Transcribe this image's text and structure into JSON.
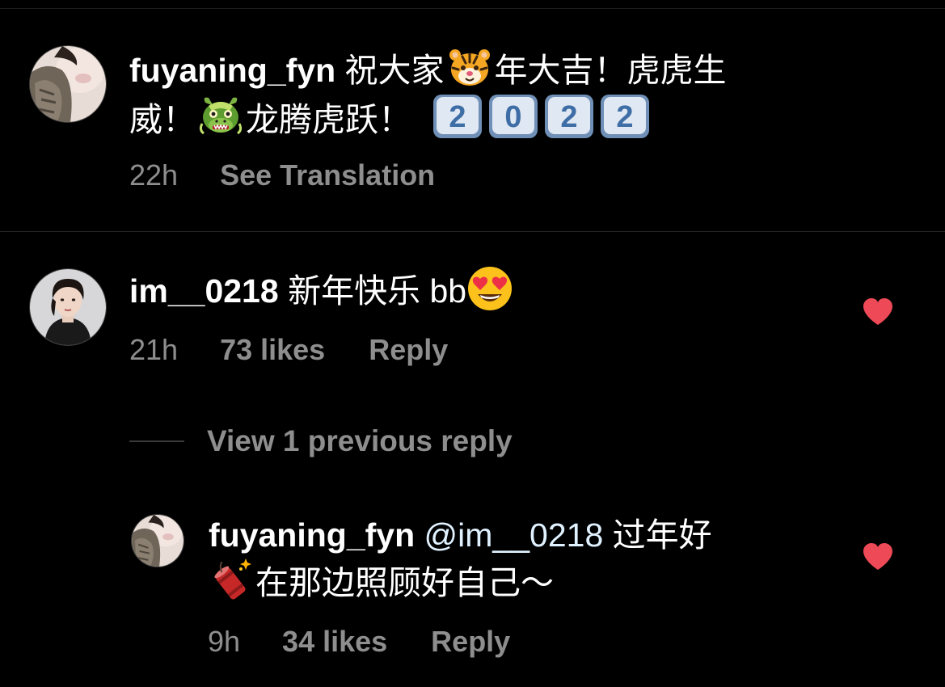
{
  "comments": [
    {
      "username": "fuyaning_fyn",
      "line1_a": " 祝大家",
      "line1_emoji": "tiger-face-emoji",
      "line1_b": "年大吉！虎虎生",
      "line2_a": "威！",
      "line2_emoji": "dragon-face-emoji",
      "line2_b": "龙腾虎跃！",
      "keycaps": [
        "2",
        "0",
        "2",
        "2"
      ],
      "time": "22h",
      "action_label": "See Translation"
    },
    {
      "username": "im__0218",
      "text": " 新年快乐 bb",
      "emoji": "heart-eyes-emoji",
      "time": "21h",
      "likes": "73 likes",
      "reply_label": "Reply",
      "liked": true,
      "heart_color": "#ed4956"
    }
  ],
  "view_replies": {
    "label": "View 1 previous reply"
  },
  "reply": {
    "username": "fuyaning_fyn",
    "mention": "@im__0218",
    "line1_text": " 过年好",
    "line2_emoji": "firecracker-emoji",
    "line2_text": "在那边照顾好自己～",
    "time": "9h",
    "likes": "34 likes",
    "reply_label": "Reply",
    "liked": true,
    "heart_color": "#ed4956"
  },
  "colors": {
    "background": "#000000",
    "primary_text": "#ffffff",
    "secondary_text": "#8e8e8e",
    "mention": "#e0f1ff",
    "like_red": "#ed4956"
  }
}
